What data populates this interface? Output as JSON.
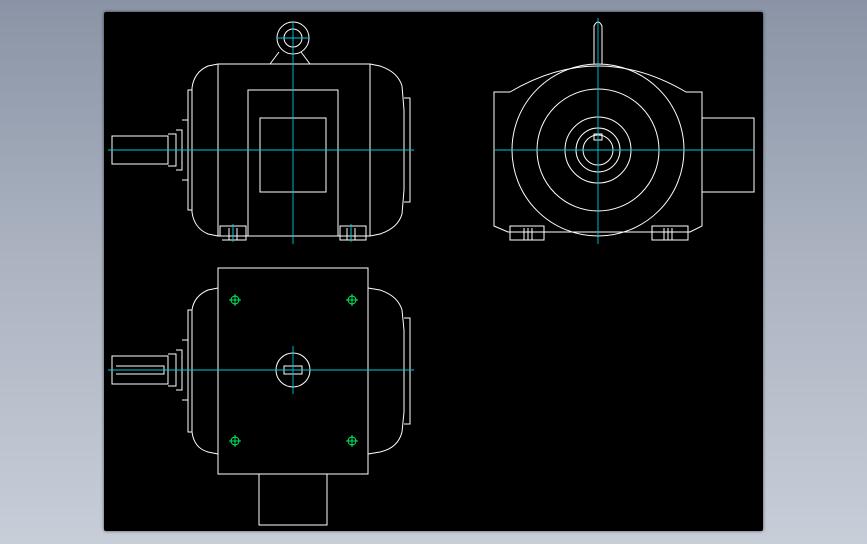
{
  "viewer": {
    "background_color": "#000000",
    "line_color": "#ffffff",
    "centerline_color": "#00c8d8",
    "hole_marker_color": "#00ff66"
  },
  "drawing": {
    "subject": "motor-with-gearbox",
    "views": [
      {
        "id": "front-view",
        "label": ""
      },
      {
        "id": "side-view",
        "label": ""
      },
      {
        "id": "top-view",
        "label": ""
      }
    ]
  }
}
